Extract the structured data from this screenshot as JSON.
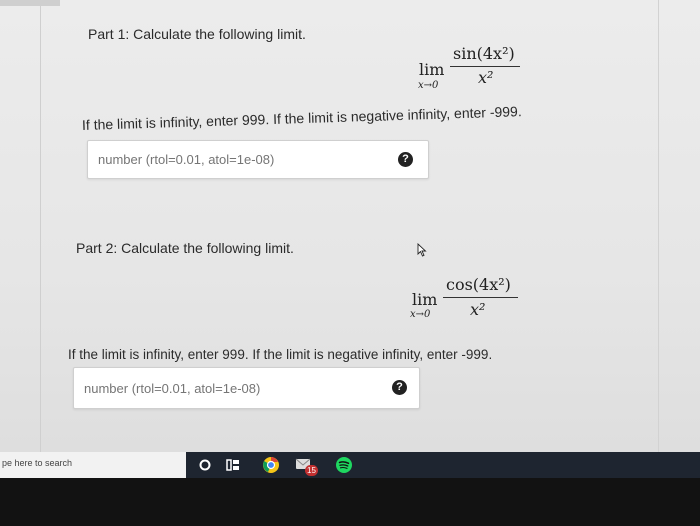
{
  "part1": {
    "title": "Part 1: Calculate the following limit.",
    "lim": "lim",
    "lim_sub": "x→0",
    "numerator": "sin(4x²)",
    "denominator": "x²",
    "hint": "If the limit is infinity, enter 999. If the limit is negative infinity, enter -999.",
    "input_placeholder": "number (rtol=0.01, atol=1e-08)",
    "help_label": "?"
  },
  "part2": {
    "title": "Part 2: Calculate the following limit.",
    "lim": "lim",
    "lim_sub": "x→0",
    "numerator": "cos(4x²)",
    "denominator": "x²",
    "hint": "If the limit is infinity, enter 999. If the limit is negative infinity, enter -999.",
    "input_placeholder": "number (rtol=0.01, atol=1e-08)",
    "help_label": "?"
  },
  "taskbar": {
    "search_placeholder": "pe here to search",
    "mail_badge": "15"
  },
  "colors": {
    "page_bg": "#e8e8e8",
    "taskbar_bg": "#1e2530",
    "chrome_yellow": "#f5c518",
    "spotify_green": "#1ed760"
  }
}
